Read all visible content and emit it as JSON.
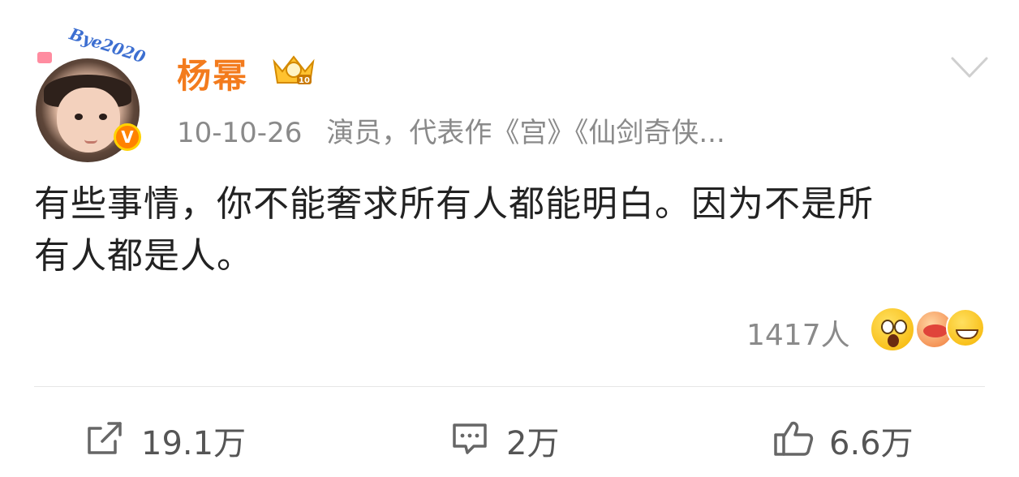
{
  "post": {
    "username": "杨幂",
    "avatar_sticker_text": "Bye2020",
    "verified_badge": "V",
    "timestamp": "10-10-26",
    "bio": "演员，代表作《宫》《仙剑奇侠...",
    "content_line1": "有些事情，你不能奢求所有人都能明白。因为不是所",
    "content_line2": "有人都是人。",
    "reactions_count": "1417人",
    "reaction_emojis": [
      "shocked-emoji",
      "blushing-emoji",
      "grinning-emoji"
    ],
    "icons": {
      "crown": "crown-icon",
      "menu": "chevron-down-icon",
      "repost": "share-icon",
      "comment": "comment-icon",
      "like": "thumbs-up-icon"
    }
  },
  "actions": {
    "repost_count": "19.1万",
    "comment_count": "2万",
    "like_count": "6.6万"
  },
  "colors": {
    "username": "#f37b1d",
    "meta_text": "#8a8a8a",
    "body_text": "#222222",
    "verified_badge": "#ff8200"
  }
}
